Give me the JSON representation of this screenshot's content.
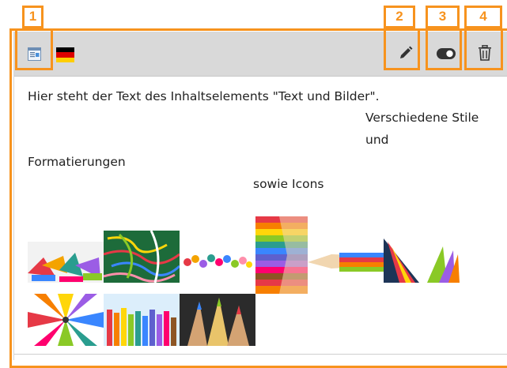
{
  "callouts": [
    "1",
    "2",
    "3",
    "4"
  ],
  "content_element": {
    "language_flag": "de-flag",
    "type_icon": "text-and-images-icon",
    "text_lines": [
      "Hier steht der Text des Inhaltselements \"Text und Bilder\".",
      "Verschiedene Stile",
      "und",
      "Formatierungen",
      "sowie Icons"
    ],
    "actions": {
      "edit_icon": "pencil-icon",
      "toggle_icon": "toggle-visibility-icon",
      "delete_icon": "trash-icon"
    },
    "images": [
      "crayons-pile-image",
      "paper-clips-image",
      "colorful-pins-image",
      "color-pencils-row-image",
      "pencil-tips-image",
      "pencils-triangle-image",
      "pencils-circle-image",
      "pencils-standing-image",
      "pencil-tips-closeup-image"
    ]
  },
  "colors": {
    "callout": "#f7931e",
    "header_bg": "#d9d9d9"
  }
}
